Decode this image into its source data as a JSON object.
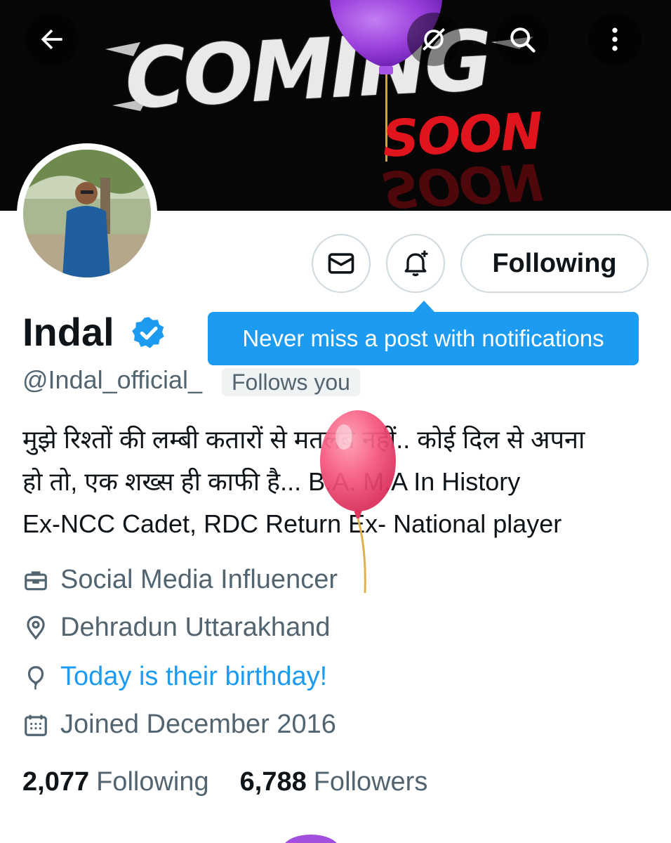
{
  "banner": {
    "headline": "COMING",
    "subline": "SOON"
  },
  "topbar": {
    "back_icon": "back-arrow-icon",
    "grok_icon": "grok-icon",
    "search_icon": "search-icon",
    "more_icon": "more-vertical-icon"
  },
  "profile": {
    "display_name": "Indal",
    "handle": "@Indal_official_",
    "follows_you": "Follows you",
    "bio_lines": [
      "मुझे रिश्तों की लम्बी कतारों से मतलब नहीं.. कोई दिल से अपना",
      "हो तो, एक शख्स ही काफी है... B.A.  M.A In History",
      "Ex-NCC Cadet, RDC Return  Ex- National player"
    ],
    "category": "Social Media Influencer",
    "location": "Dehradun Uttarakhand",
    "birthday": "Today is their birthday!",
    "joined": "Joined December 2016"
  },
  "actions": {
    "message_icon": "envelope-icon",
    "notify_icon": "bell-plus-icon",
    "following_label": "Following"
  },
  "tooltip": {
    "text": "Never miss a post with notifications"
  },
  "stats": {
    "following_count": "2,077",
    "following_label": "Following",
    "followers_count": "6,788",
    "followers_label": "Followers"
  },
  "colors": {
    "accent": "#1d9bf0",
    "text": "#0f1419",
    "secondary": "#536471",
    "border": "#cfd9de"
  }
}
